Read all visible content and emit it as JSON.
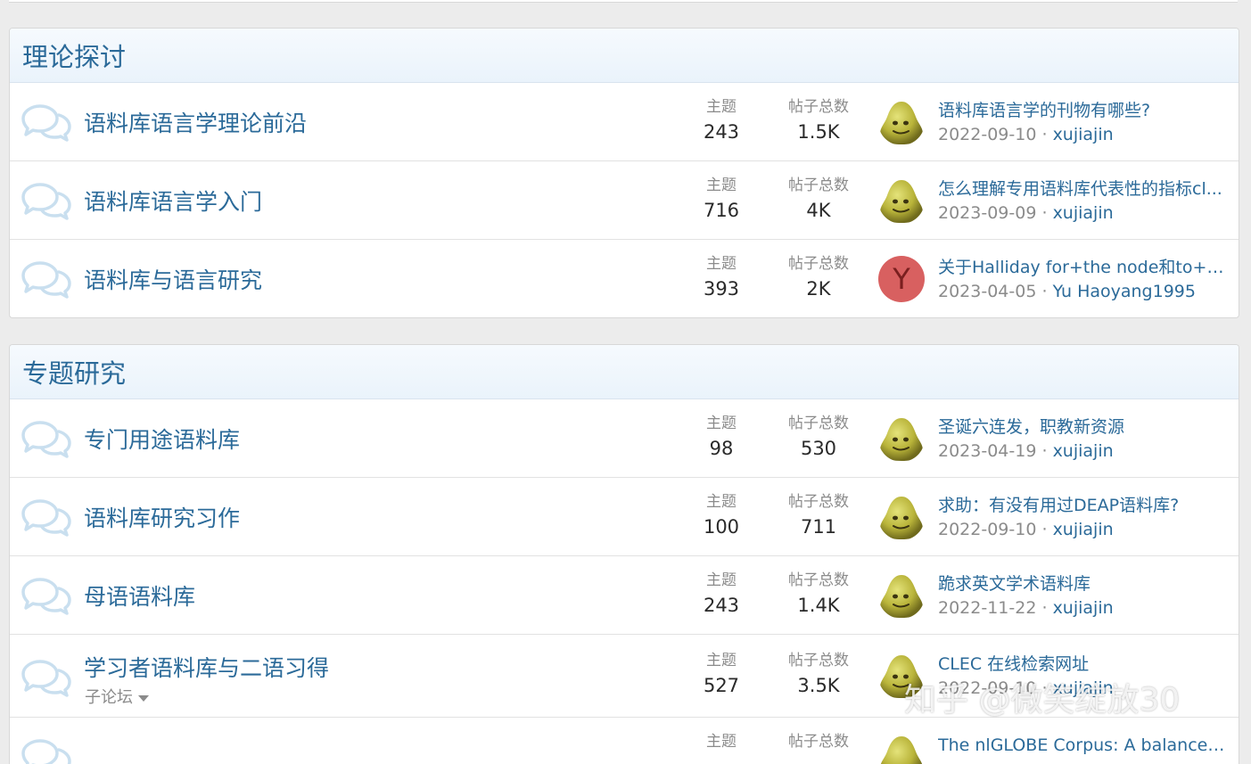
{
  "categories": [
    {
      "title": "理论探讨",
      "forums": [
        {
          "title": "语料库语言学理论前沿",
          "topics_label": "主题",
          "topics": "243",
          "posts_label": "帖子总数",
          "posts": "1.5K",
          "latest_title": "语料库语言学的刊物有哪些?",
          "latest_date": "2022-09-10",
          "separator": "·",
          "latest_user": "xujiajin",
          "avatar": "pear"
        },
        {
          "title": "语料库语言学入门",
          "topics_label": "主题",
          "topics": "716",
          "posts_label": "帖子总数",
          "posts": "4K",
          "latest_title": "怎么理解专用语料库代表性的指标cl...",
          "latest_date": "2023-09-09",
          "separator": "·",
          "latest_user": "xujiajin",
          "avatar": "pear"
        },
        {
          "title": "语料库与语言研究",
          "topics_label": "主题",
          "topics": "393",
          "posts_label": "帖子总数",
          "posts": "2K",
          "latest_title": "关于Halliday for+the node和to+th...",
          "latest_date": "2023-04-05",
          "separator": "·",
          "latest_user": "Yu Haoyang1995",
          "avatar": "letter",
          "avatar_letter": "Y"
        }
      ]
    },
    {
      "title": "专题研究",
      "forums": [
        {
          "title": "专门用途语料库",
          "topics_label": "主题",
          "topics": "98",
          "posts_label": "帖子总数",
          "posts": "530",
          "latest_title": "圣诞六连发，职教新资源",
          "latest_date": "2023-04-19",
          "separator": "·",
          "latest_user": "xujiajin",
          "avatar": "pear"
        },
        {
          "title": "语料库研究习作",
          "topics_label": "主题",
          "topics": "100",
          "posts_label": "帖子总数",
          "posts": "711",
          "latest_title": "求助：有没有用过DEAP语料库?",
          "latest_date": "2022-09-10",
          "separator": "·",
          "latest_user": "xujiajin",
          "avatar": "pear"
        },
        {
          "title": "母语语料库",
          "topics_label": "主题",
          "topics": "243",
          "posts_label": "帖子总数",
          "posts": "1.4K",
          "latest_title": "跪求英文学术语料库",
          "latest_date": "2022-11-22",
          "separator": "·",
          "latest_user": "xujiajin",
          "avatar": "pear"
        },
        {
          "title": "学习者语料库与二语习得",
          "subforum_label": "子论坛",
          "topics_label": "主题",
          "topics": "527",
          "posts_label": "帖子总数",
          "posts": "3.5K",
          "latest_title": "CLEC 在线检索网址",
          "latest_date": "2022-09-10",
          "separator": "·",
          "latest_user": "xujiajin",
          "avatar": "pear"
        },
        {
          "title": "",
          "topics_label": "主题",
          "topics": "",
          "posts_label": "帖子总数",
          "posts": "",
          "latest_title": "The nlGLOBE Corpus: A balanced c...",
          "latest_date": "",
          "separator": "",
          "latest_user": "",
          "avatar": "pear"
        }
      ]
    }
  ],
  "watermark": "知乎 @微笑绽放30",
  "colors": {
    "link": "#2b6a99",
    "muted": "#8b8b8b",
    "page_bg": "#ececec",
    "header_bg": "#eaf3fb",
    "icon": "#c9dfef"
  }
}
